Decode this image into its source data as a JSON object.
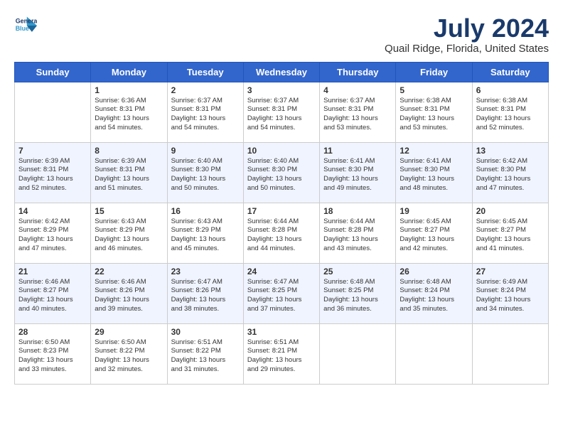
{
  "logo": {
    "line1": "General",
    "line2": "Blue"
  },
  "title": "July 2024",
  "subtitle": "Quail Ridge, Florida, United States",
  "weekdays": [
    "Sunday",
    "Monday",
    "Tuesday",
    "Wednesday",
    "Thursday",
    "Friday",
    "Saturday"
  ],
  "weeks": [
    [
      {
        "day": "",
        "content": ""
      },
      {
        "day": "1",
        "content": "Sunrise: 6:36 AM\nSunset: 8:31 PM\nDaylight: 13 hours\nand 54 minutes."
      },
      {
        "day": "2",
        "content": "Sunrise: 6:37 AM\nSunset: 8:31 PM\nDaylight: 13 hours\nand 54 minutes."
      },
      {
        "day": "3",
        "content": "Sunrise: 6:37 AM\nSunset: 8:31 PM\nDaylight: 13 hours\nand 54 minutes."
      },
      {
        "day": "4",
        "content": "Sunrise: 6:37 AM\nSunset: 8:31 PM\nDaylight: 13 hours\nand 53 minutes."
      },
      {
        "day": "5",
        "content": "Sunrise: 6:38 AM\nSunset: 8:31 PM\nDaylight: 13 hours\nand 53 minutes."
      },
      {
        "day": "6",
        "content": "Sunrise: 6:38 AM\nSunset: 8:31 PM\nDaylight: 13 hours\nand 52 minutes."
      }
    ],
    [
      {
        "day": "7",
        "content": "Sunrise: 6:39 AM\nSunset: 8:31 PM\nDaylight: 13 hours\nand 52 minutes."
      },
      {
        "day": "8",
        "content": "Sunrise: 6:39 AM\nSunset: 8:31 PM\nDaylight: 13 hours\nand 51 minutes."
      },
      {
        "day": "9",
        "content": "Sunrise: 6:40 AM\nSunset: 8:30 PM\nDaylight: 13 hours\nand 50 minutes."
      },
      {
        "day": "10",
        "content": "Sunrise: 6:40 AM\nSunset: 8:30 PM\nDaylight: 13 hours\nand 50 minutes."
      },
      {
        "day": "11",
        "content": "Sunrise: 6:41 AM\nSunset: 8:30 PM\nDaylight: 13 hours\nand 49 minutes."
      },
      {
        "day": "12",
        "content": "Sunrise: 6:41 AM\nSunset: 8:30 PM\nDaylight: 13 hours\nand 48 minutes."
      },
      {
        "day": "13",
        "content": "Sunrise: 6:42 AM\nSunset: 8:30 PM\nDaylight: 13 hours\nand 47 minutes."
      }
    ],
    [
      {
        "day": "14",
        "content": "Sunrise: 6:42 AM\nSunset: 8:29 PM\nDaylight: 13 hours\nand 47 minutes."
      },
      {
        "day": "15",
        "content": "Sunrise: 6:43 AM\nSunset: 8:29 PM\nDaylight: 13 hours\nand 46 minutes."
      },
      {
        "day": "16",
        "content": "Sunrise: 6:43 AM\nSunset: 8:29 PM\nDaylight: 13 hours\nand 45 minutes."
      },
      {
        "day": "17",
        "content": "Sunrise: 6:44 AM\nSunset: 8:28 PM\nDaylight: 13 hours\nand 44 minutes."
      },
      {
        "day": "18",
        "content": "Sunrise: 6:44 AM\nSunset: 8:28 PM\nDaylight: 13 hours\nand 43 minutes."
      },
      {
        "day": "19",
        "content": "Sunrise: 6:45 AM\nSunset: 8:27 PM\nDaylight: 13 hours\nand 42 minutes."
      },
      {
        "day": "20",
        "content": "Sunrise: 6:45 AM\nSunset: 8:27 PM\nDaylight: 13 hours\nand 41 minutes."
      }
    ],
    [
      {
        "day": "21",
        "content": "Sunrise: 6:46 AM\nSunset: 8:27 PM\nDaylight: 13 hours\nand 40 minutes."
      },
      {
        "day": "22",
        "content": "Sunrise: 6:46 AM\nSunset: 8:26 PM\nDaylight: 13 hours\nand 39 minutes."
      },
      {
        "day": "23",
        "content": "Sunrise: 6:47 AM\nSunset: 8:26 PM\nDaylight: 13 hours\nand 38 minutes."
      },
      {
        "day": "24",
        "content": "Sunrise: 6:47 AM\nSunset: 8:25 PM\nDaylight: 13 hours\nand 37 minutes."
      },
      {
        "day": "25",
        "content": "Sunrise: 6:48 AM\nSunset: 8:25 PM\nDaylight: 13 hours\nand 36 minutes."
      },
      {
        "day": "26",
        "content": "Sunrise: 6:48 AM\nSunset: 8:24 PM\nDaylight: 13 hours\nand 35 minutes."
      },
      {
        "day": "27",
        "content": "Sunrise: 6:49 AM\nSunset: 8:24 PM\nDaylight: 13 hours\nand 34 minutes."
      }
    ],
    [
      {
        "day": "28",
        "content": "Sunrise: 6:50 AM\nSunset: 8:23 PM\nDaylight: 13 hours\nand 33 minutes."
      },
      {
        "day": "29",
        "content": "Sunrise: 6:50 AM\nSunset: 8:22 PM\nDaylight: 13 hours\nand 32 minutes."
      },
      {
        "day": "30",
        "content": "Sunrise: 6:51 AM\nSunset: 8:22 PM\nDaylight: 13 hours\nand 31 minutes."
      },
      {
        "day": "31",
        "content": "Sunrise: 6:51 AM\nSunset: 8:21 PM\nDaylight: 13 hours\nand 29 minutes."
      },
      {
        "day": "",
        "content": ""
      },
      {
        "day": "",
        "content": ""
      },
      {
        "day": "",
        "content": ""
      }
    ]
  ]
}
